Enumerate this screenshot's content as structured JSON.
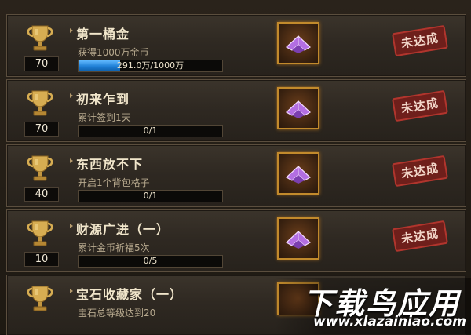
{
  "achievements": [
    {
      "title": "第一桶金",
      "desc": "获得1000万金币",
      "points": "70",
      "progress_text": "291.0万/1000万",
      "progress": 0.291,
      "status": "未达成"
    },
    {
      "title": "初来乍到",
      "desc": "累计签到1天",
      "points": "70",
      "progress_text": "0/1",
      "progress": 0,
      "status": "未达成"
    },
    {
      "title": "东西放不下",
      "desc": "开启1个背包格子",
      "points": "40",
      "progress_text": "0/1",
      "progress": 0,
      "status": "未达成"
    },
    {
      "title": "财源广进（一）",
      "desc": "累计金币祈福5次",
      "points": "10",
      "progress_text": "0/5",
      "progress": 0,
      "status": "未达成"
    },
    {
      "title": "宝石收藏家（一）",
      "desc": "宝石总等级达到20",
      "points": "",
      "progress_text": "",
      "progress": 0,
      "status": ""
    }
  ],
  "watermark": {
    "title": "下载鸟应用",
    "url": "www.xlazainiao.com"
  },
  "colors": {
    "progress": "#1f7fd6",
    "stamp": "#b1352d",
    "reward_border": "#c28a2c",
    "title": "#f1e6cb"
  },
  "icons": {
    "trophy": "trophy-icon",
    "reward": "purple-crystal-icon"
  }
}
